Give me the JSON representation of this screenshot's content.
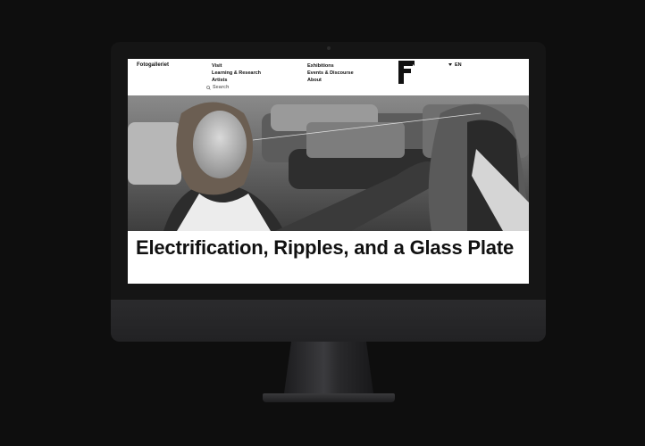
{
  "site": {
    "brand": "Fotogalleriet",
    "nav_col1": [
      "Visit",
      "Learning & Research",
      "Artists"
    ],
    "nav_col2": [
      "Exhibitions",
      "Events & Discourse",
      "About"
    ],
    "search_label": "Search",
    "language": "EN",
    "logo_icon": "fotogalleriet-f-logo"
  },
  "hero": {
    "image": "black-and-white-photo-smiling-woman-parking-lot"
  },
  "page": {
    "title": "Electrification, Ripples, and a Glass Plate"
  }
}
